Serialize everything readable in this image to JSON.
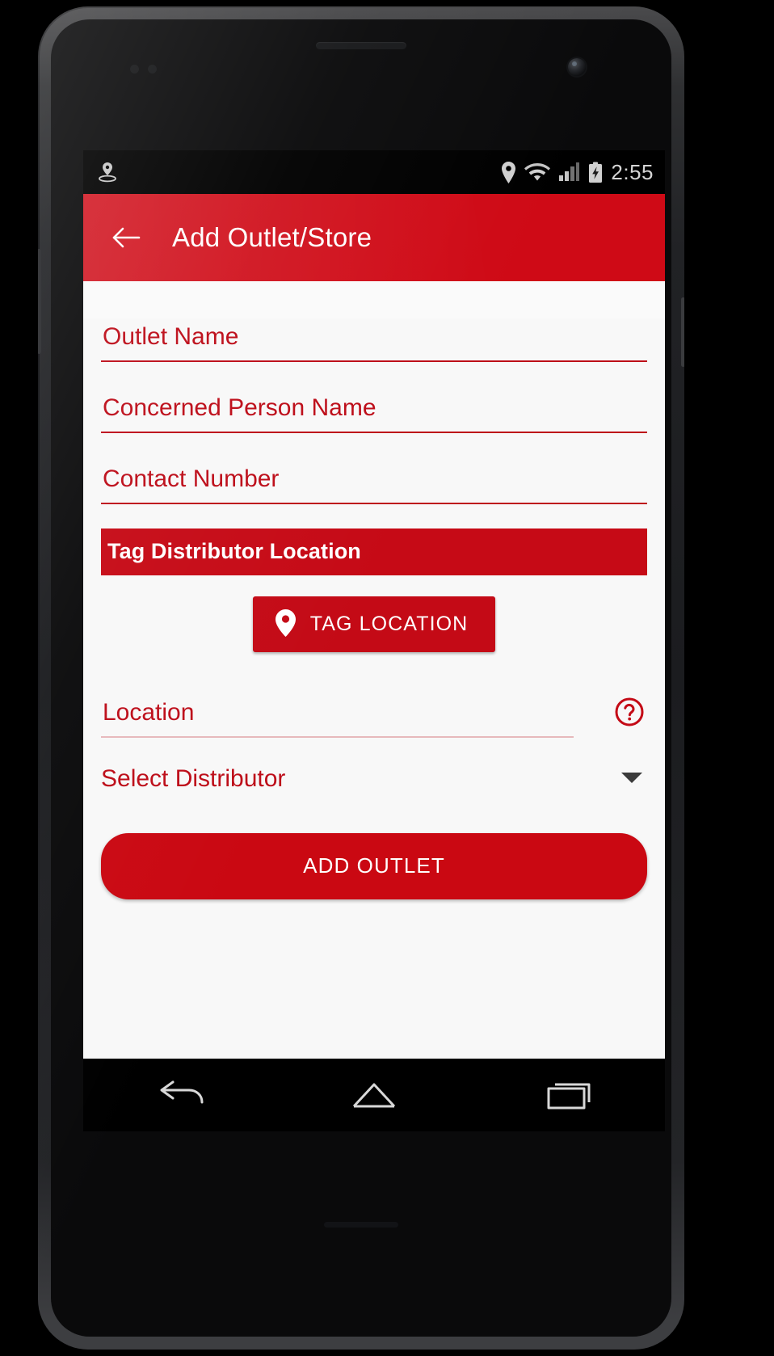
{
  "status_bar": {
    "time": "2:55",
    "left_icons": [
      "location-history-icon"
    ],
    "right_icons": [
      "location-icon",
      "wifi-icon",
      "signal-icon",
      "battery-charging-icon"
    ]
  },
  "app_bar": {
    "title": "Add Outlet/Store",
    "back_icon": "arrow-left-icon",
    "background_color": "#cf0a16"
  },
  "form": {
    "outlet_name": {
      "placeholder": "Outlet Name",
      "value": ""
    },
    "concerned_person": {
      "placeholder": "Concerned Person Name",
      "value": ""
    },
    "contact_number": {
      "placeholder": "Contact Number",
      "value": ""
    },
    "section_header": "Tag Distributor Location",
    "tag_location_button": {
      "label": "TAG LOCATION",
      "icon": "map-pin-icon"
    },
    "location": {
      "placeholder": "Location",
      "value": ""
    },
    "help_icon": "help-circle-icon",
    "distributor_spinner": {
      "selected": "Select Distributor",
      "caret_icon": "chevron-down-icon"
    },
    "submit_button": "ADD OUTLET"
  },
  "nav_bar": {
    "back": "back-nav-icon",
    "home": "home-nav-icon",
    "recents": "recents-nav-icon"
  },
  "colors": {
    "brand_red": "#cf0a16",
    "field_red": "#bd0c18",
    "disabled_underline": "#e7b9bc",
    "screen_bg": "#f8f8f8"
  }
}
